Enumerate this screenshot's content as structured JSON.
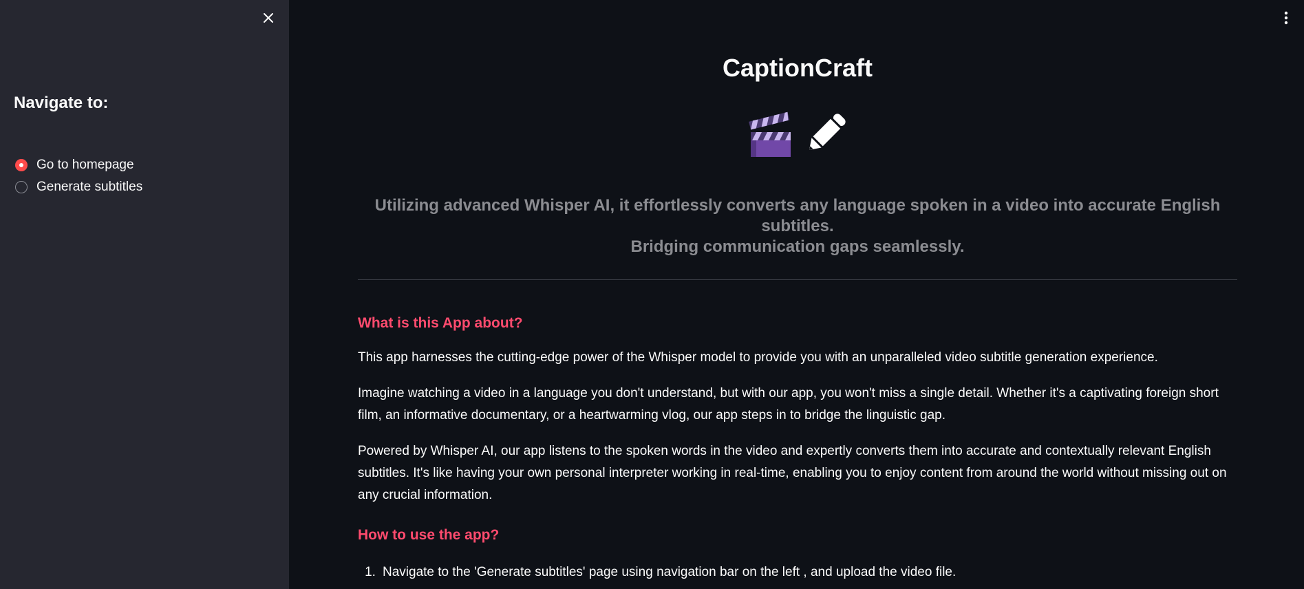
{
  "sidebar": {
    "heading": "Navigate to:",
    "options": [
      {
        "label": "Go to homepage",
        "checked": true
      },
      {
        "label": "Generate subtitles",
        "checked": false
      }
    ],
    "accent_color": "#ff4b4b",
    "close_icon": "close-icon"
  },
  "main": {
    "title": "CaptionCraft",
    "icons": [
      "clapper-board-icon",
      "pencil-icon"
    ],
    "subtitle_line1": "Utilizing advanced Whisper AI, it effortlessly converts any language spoken in a video into accurate English subtitles.",
    "subtitle_line2": "Bridging communication gaps seamlessly.",
    "about_heading": "What is this App about?",
    "about_paragraphs": [
      "This app harnesses the cutting-edge power of the Whisper model to provide you with an unparalleled video subtitle generation experience.",
      "Imagine watching a video in a language you don't understand, but with our app, you won't miss a single detail. Whether it's a captivating foreign short film, an informative documentary, or a heartwarming vlog, our app steps in to bridge the linguistic gap.",
      "Powered by Whisper AI, our app listens to the spoken words in the video and expertly converts them into accurate and contextually relevant English subtitles. It's like having your own personal interpreter working in real-time, enabling you to enjoy content from around the world without missing out on any crucial information."
    ],
    "howto_heading": "How to use the app?",
    "howto_steps": [
      {
        "num": "1.",
        "text": "Navigate to the 'Generate subtitles' page using navigation bar on the left , and upload the video file."
      }
    ],
    "heading_color": "#ff4b6e",
    "menu_icon": "kebab-menu-icon"
  }
}
